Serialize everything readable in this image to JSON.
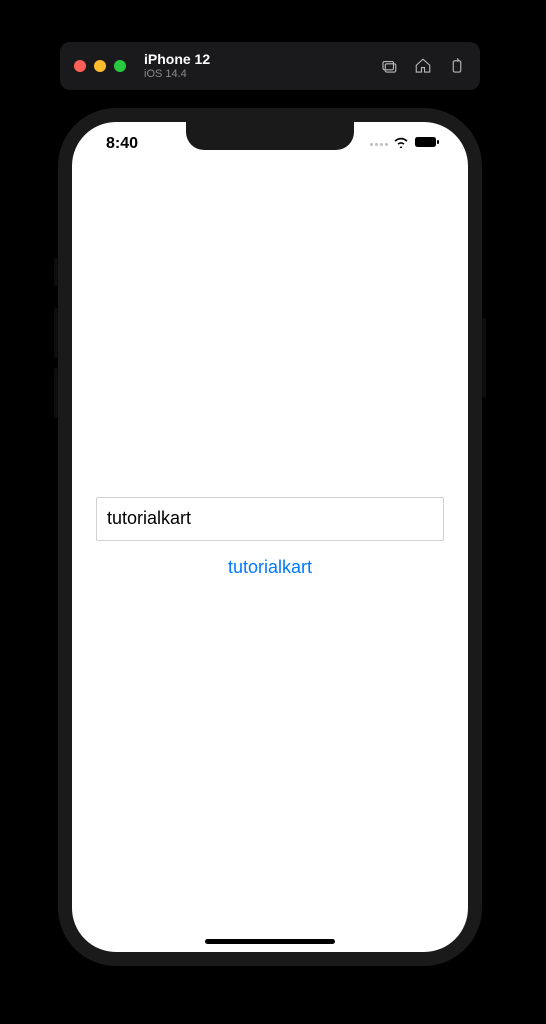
{
  "simulator": {
    "device_name": "iPhone 12",
    "os_version": "iOS 14.4"
  },
  "status_bar": {
    "time": "8:40"
  },
  "app": {
    "textfield_value": "tutorialkart",
    "label_text": "tutorialkart"
  }
}
